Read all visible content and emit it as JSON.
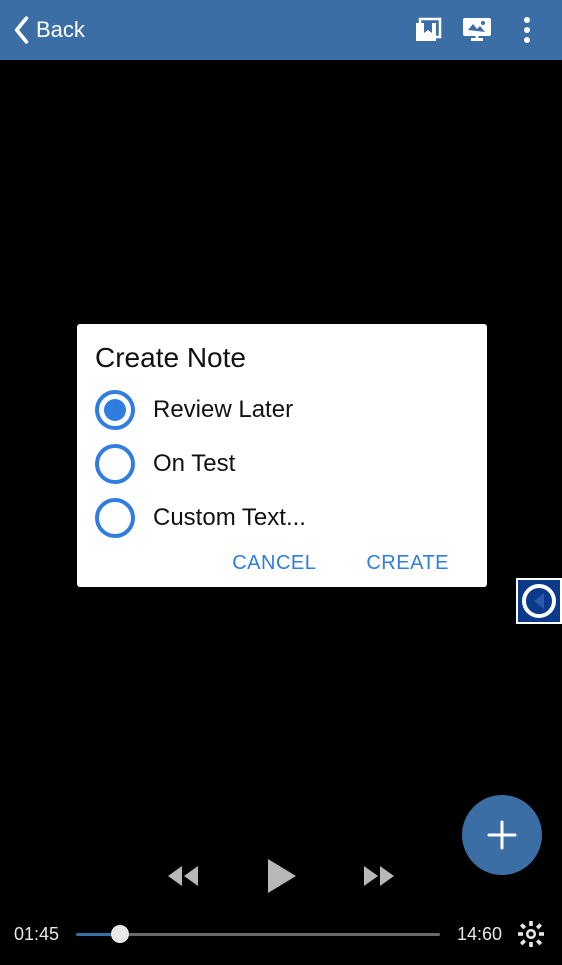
{
  "header": {
    "back_label": "Back",
    "icons": [
      "bookmark-collection-icon",
      "slideshow-icon",
      "more-vertical-icon"
    ]
  },
  "dialog": {
    "title": "Create Note",
    "options": [
      {
        "label": "Review Later",
        "selected": true
      },
      {
        "label": "On Test",
        "selected": false
      },
      {
        "label": "Custom Text...",
        "selected": false
      }
    ],
    "cancel_label": "CANCEL",
    "create_label": "CREATE"
  },
  "playback": {
    "current_time": "01:45",
    "total_time": "14:60",
    "progress_percent": 12
  },
  "colors": {
    "accent": "#3b6ea5",
    "link": "#2f7de1"
  }
}
